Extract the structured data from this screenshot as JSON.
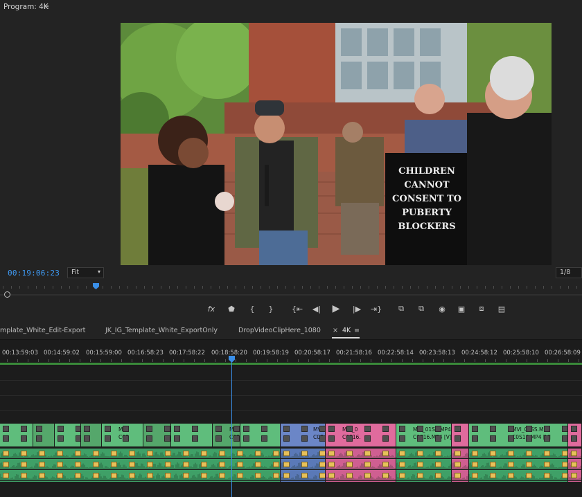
{
  "monitor": {
    "title": "Program: 4K",
    "menu_icon": "hamburger-icon",
    "timecode": "00:19:06:23",
    "fit": "Fit",
    "resolution": "1/8",
    "sign_text": [
      "CHILDREN",
      "CANNOT",
      "CONSENT TO",
      "PUBERTY",
      "BLOCKERS"
    ],
    "transport_icons": [
      "fx-icon",
      "marker-icon",
      "mark-in-icon",
      "mark-out-icon",
      "go-to-in-icon",
      "step-back-icon",
      "play-icon",
      "step-forward-icon",
      "go-to-out-icon",
      "lift-icon",
      "extract-icon",
      "export-frame-icon",
      "comparison-view-icon",
      "proxy-toggle-icon",
      "multicam-icon"
    ],
    "fx_label": "fx"
  },
  "timeline": {
    "tabs": [
      {
        "label": "mplate_White_Edit-Export"
      },
      {
        "label": "JK_IG_Template_White_ExportOnly"
      },
      {
        "label": "DropVideoClipHere_1080"
      },
      {
        "label": "4K",
        "active": true
      }
    ],
    "close_glyph": "×",
    "menu_glyph": "≡",
    "ruler": [
      "00:13:59:03",
      "00:14:59:02",
      "00:15:59:00",
      "00:16:58:23",
      "00:17:58:22",
      "00:18:58:20",
      "00:19:58:19",
      "00:20:58:17",
      "00:21:58:16",
      "00:22:58:14",
      "00:23:58:13",
      "00:24:58:12",
      "00:25:58:10",
      "00:26:58:09"
    ],
    "clip_labels": {
      "short1": "MVI",
      "short1b": "C0S",
      "short2": "MVI",
      "short2b": "C0S",
      "short3": "MVI",
      "short3b": "C0S",
      "mid": "MVI_0",
      "midb": "C0S16.",
      "long1": "MVI_01SS.MP4",
      "long1b": "C0S16.MP4 [V]",
      "long2": "MVI_01SS.MP4",
      "long2b": "C0S16.MP4 [V]"
    },
    "colors": {
      "green": "#5fbd7c",
      "green_dark": "#55a76b",
      "blue": "#6b86c7",
      "pink": "#e06b9d",
      "audio_green": "#3fa067",
      "audio_blue": "#5a79b7",
      "audio_pink": "#cf5f91"
    }
  }
}
